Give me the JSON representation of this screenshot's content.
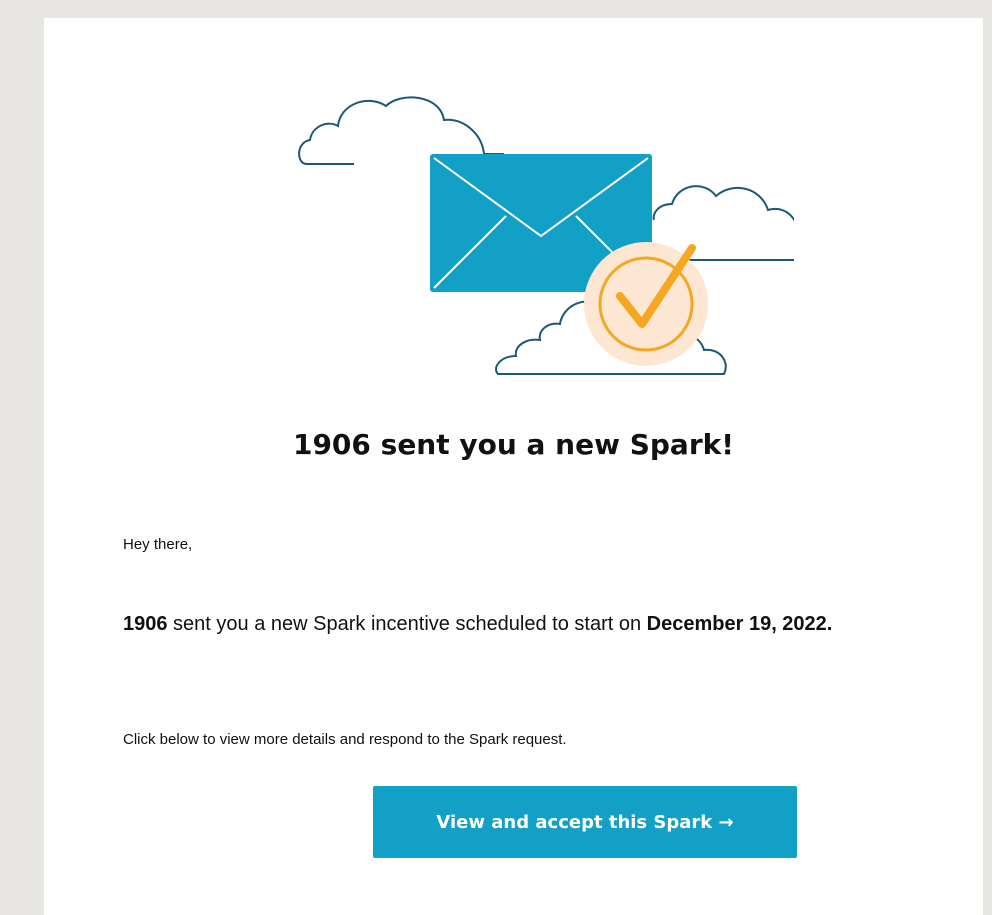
{
  "email": {
    "headline": "1906 sent you a new Spark!",
    "greeting": "Hey there,",
    "message": {
      "sender": "1906",
      "text": " sent you a new Spark incentive scheduled to start on ",
      "date": "December 19, 2022."
    },
    "instruction": "Click below to view more details and respond to the Spark request.",
    "cta_label": "View and accept this Spark →"
  },
  "colors": {
    "page_background": "#e7e6e2",
    "card_background": "#ffffff",
    "envelope": "#12a0c6",
    "cloud_stroke": "#1b5875",
    "check_circle_fill": "#fde7d2",
    "check_stroke": "#f5a623",
    "button": "#12a0c6"
  },
  "icons": [
    "cloud-icon",
    "envelope-icon",
    "checkmark-badge-icon"
  ]
}
